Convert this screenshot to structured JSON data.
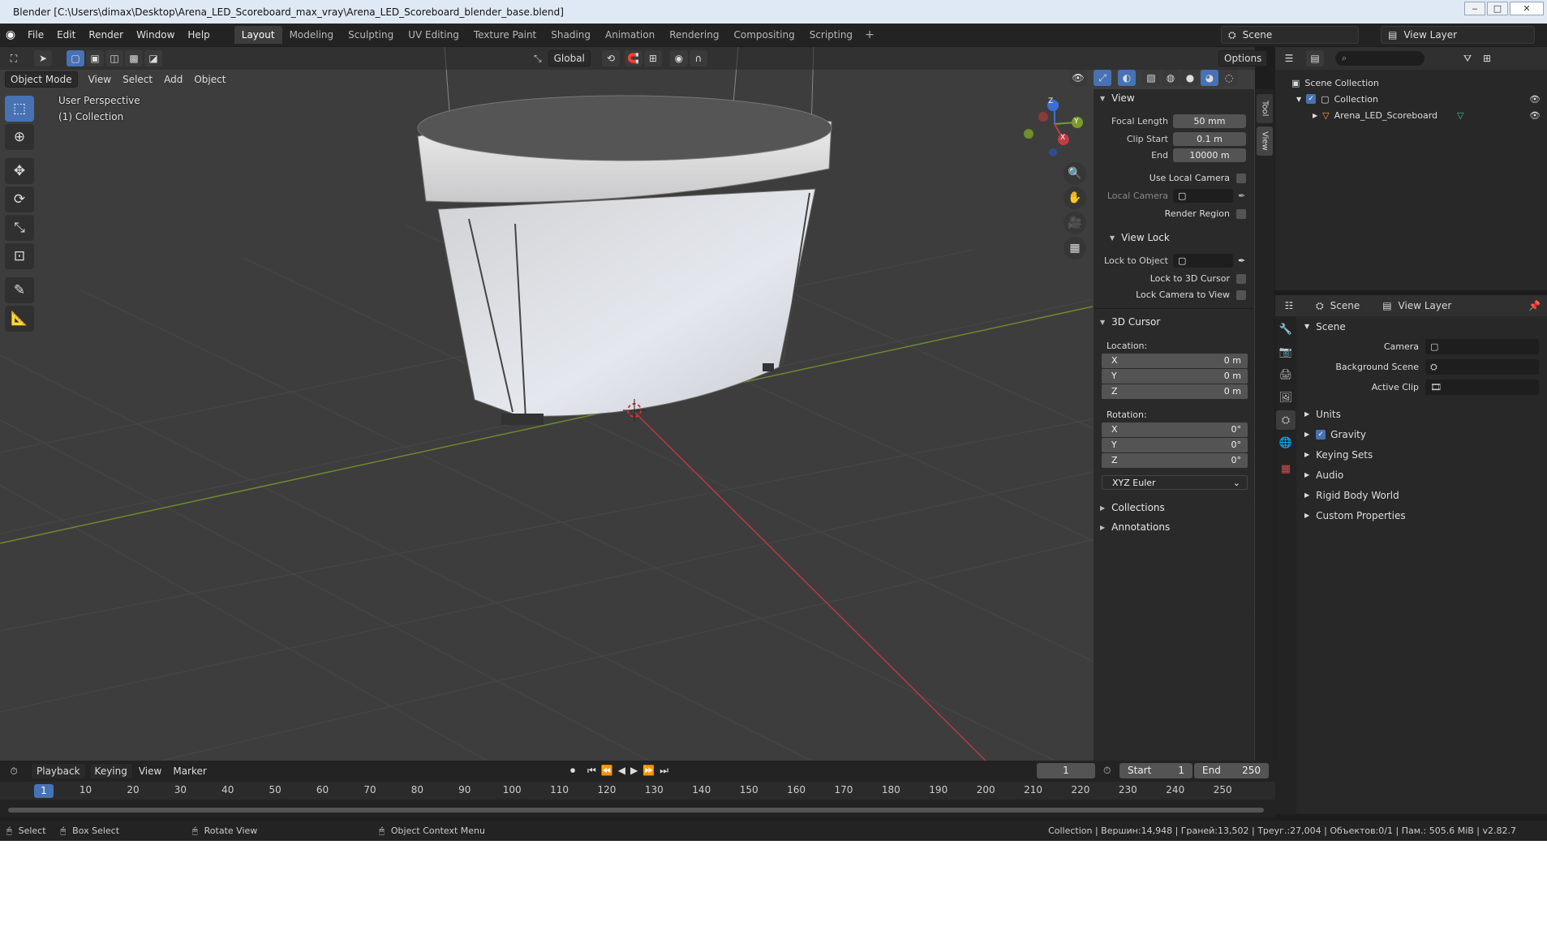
{
  "window": {
    "title": "Blender [C:\\Users\\dimax\\Desktop\\Arena_LED_Scoreboard_max_vray\\Arena_LED_Scoreboard_blender_base.blend]",
    "minimize": "‒",
    "restore": "□",
    "close": "✕"
  },
  "menu": {
    "file": "File",
    "edit": "Edit",
    "render": "Render",
    "window": "Window",
    "help": "Help"
  },
  "workspaces": [
    "Layout",
    "Modeling",
    "Sculpting",
    "UV Editing",
    "Texture Paint",
    "Shading",
    "Animation",
    "Rendering",
    "Compositing",
    "Scripting"
  ],
  "workspace_add": "+",
  "scene_selector": {
    "scene": "Scene",
    "view_layer": "View Layer"
  },
  "viewport_header": {
    "transform_orientation": "Global",
    "options": "Options",
    "mode": "Object Mode",
    "view": "View",
    "select": "Select",
    "add": "Add",
    "object": "Object"
  },
  "viewport_info": {
    "perspective": "User Perspective",
    "collection": "(1) Collection"
  },
  "gizmo": {
    "z": "Z",
    "y": "Y",
    "x": "X"
  },
  "npanel": {
    "tabs": {
      "tool": "Tool",
      "view": "View"
    },
    "view": {
      "heading": "View",
      "focal_length_label": "Focal Length",
      "focal_length": "50 mm",
      "clip_start_label": "Clip Start",
      "clip_start": "0.1 m",
      "end_label": "End",
      "end": "10000 m",
      "use_local_camera": "Use Local Camera",
      "local_camera": "Local Camera",
      "render_region": "Render Region"
    },
    "view_lock": {
      "heading": "View Lock",
      "lock_to_object": "Lock to Object",
      "lock_to_3d_cursor": "Lock to 3D Cursor",
      "lock_camera_to_view": "Lock Camera to View"
    },
    "cursor": {
      "heading": "3D Cursor",
      "location_label": "Location:",
      "location": [
        {
          "axis": "X",
          "value": "0 m"
        },
        {
          "axis": "Y",
          "value": "0 m"
        },
        {
          "axis": "Z",
          "value": "0 m"
        }
      ],
      "rotation_label": "Rotation:",
      "rotation": [
        {
          "axis": "X",
          "value": "0°"
        },
        {
          "axis": "Y",
          "value": "0°"
        },
        {
          "axis": "Z",
          "value": "0°"
        }
      ],
      "rotation_mode": "XYZ Euler"
    },
    "collections": "Collections",
    "annotations": "Annotations"
  },
  "outliner": {
    "scene_collection": "Scene Collection",
    "collection": "Collection",
    "object": "Arena_LED_Scoreboard"
  },
  "properties": {
    "header_scene": "Scene",
    "header_view_layer": "View Layer",
    "section": "Scene",
    "camera_label": "Camera",
    "background_scene_label": "Background Scene",
    "active_clip_label": "Active Clip",
    "panels": [
      "Units",
      "Gravity",
      "Keying Sets",
      "Audio",
      "Rigid Body World",
      "Custom Properties"
    ]
  },
  "timeline": {
    "playback": "Playback",
    "keying": "Keying",
    "view": "View",
    "marker": "Marker",
    "current_frame": "1",
    "start_label": "Start",
    "start": "1",
    "end_label": "End",
    "end": "250",
    "ruler_frame": "1",
    "ticks": [
      "10",
      "20",
      "30",
      "40",
      "50",
      "60",
      "70",
      "80",
      "90",
      "100",
      "110",
      "120",
      "130",
      "140",
      "150",
      "160",
      "170",
      "180",
      "190",
      "200",
      "210",
      "220",
      "230",
      "240",
      "250"
    ]
  },
  "statusbar": {
    "select": "Select",
    "box_select": "Box Select",
    "rotate_view": "Rotate View",
    "context_menu": "Object Context Menu",
    "stats": "Collection | Вершин:14,948 | Граней:13,502 | Треуг.:27,004 | Объектов:0/1 | Пам.: 505.6 MiB | v2.82.7"
  },
  "colors": {
    "accent": "#4772b3",
    "axis_x": "#c23a44",
    "axis_y": "#7c9a2a",
    "grid_bg": "#3d3d3d"
  }
}
